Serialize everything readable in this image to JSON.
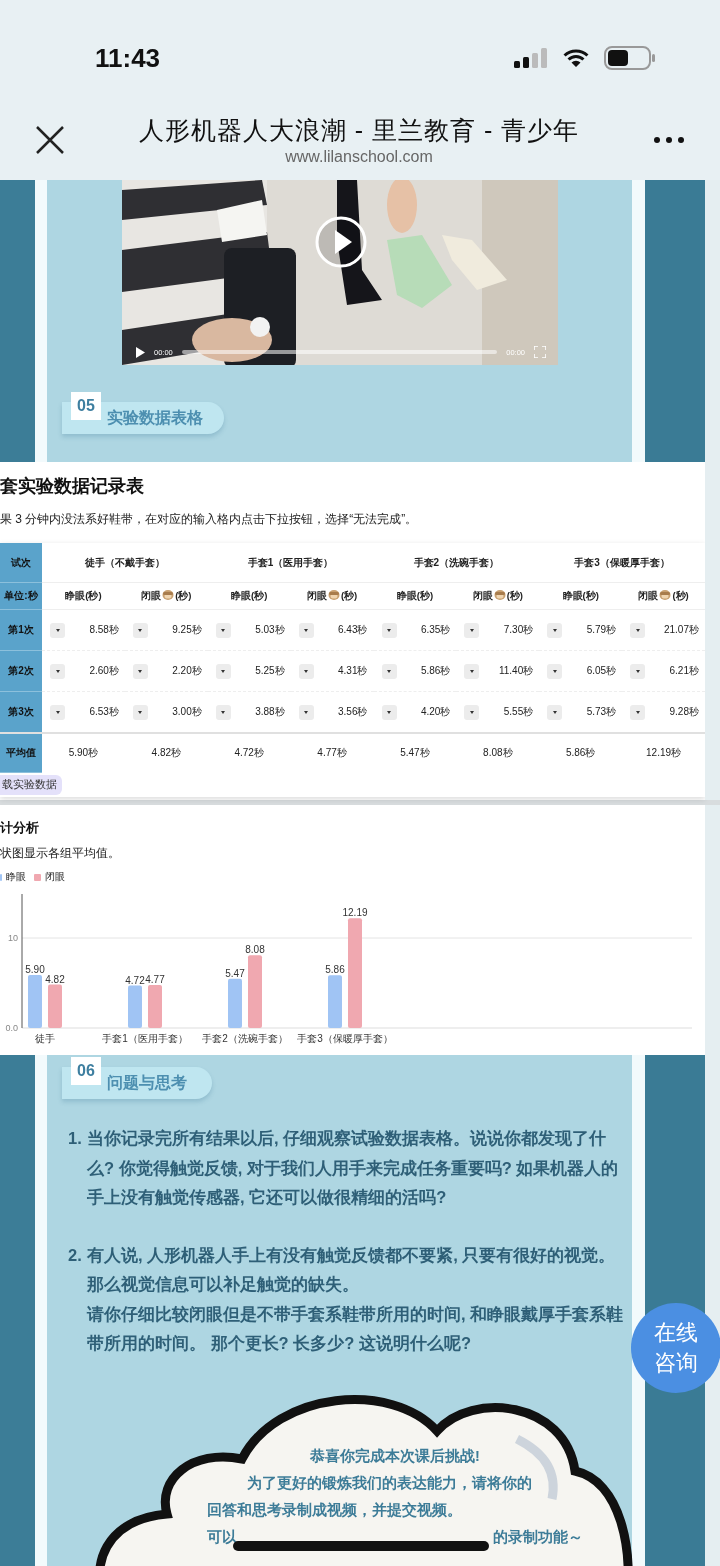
{
  "status_bar": {
    "time": "11:43"
  },
  "browser": {
    "title": "人形机器人大浪潮 - 里兰教育 - 青少年",
    "url": "www.lilanschool.com"
  },
  "video": {
    "kind": "picture",
    "current_time": "00:00",
    "duration": "00:00",
    "level": 0
  },
  "section_05": {
    "number": "05",
    "title": "实验数据表格"
  },
  "table_panel": {
    "title": "套实验数据记录表",
    "note": "果 3 分钟内没法系好鞋带，在对应的输入格内点击下拉按钮，选择“无法完成”。",
    "download_button": "载实验数据"
  },
  "table": {
    "corner": "试次",
    "unit": "单位:秒",
    "groups": [
      "徒手（不戴手套）",
      "手套1（医用手套）",
      "手套2（洗碗手套）",
      "手套3（保暖厚手套）"
    ],
    "subheads": [
      {
        "kind": "text",
        "text": "睁眼(秒)"
      },
      {
        "kind": "emoji",
        "before": "闭眼",
        "after": "(秒)"
      },
      {
        "kind": "text",
        "text": "睁眼(秒)"
      },
      {
        "kind": "emoji",
        "before": "闭眼",
        "after": "(秒)"
      },
      {
        "kind": "text",
        "text": "睁眼(秒)"
      },
      {
        "kind": "emoji",
        "before": "闭眼",
        "after": "(秒)"
      },
      {
        "kind": "text",
        "text": "睁眼(秒)"
      },
      {
        "kind": "emoji",
        "before": "闭眼",
        "after": "(秒)"
      }
    ],
    "rows": [
      {
        "label": "第1次",
        "cells": [
          "8.58秒",
          "9.25秒",
          "5.03秒",
          "6.43秒",
          "6.35秒",
          "7.30秒",
          "5.79秒",
          "21.07秒"
        ]
      },
      {
        "label": "第2次",
        "cells": [
          "2.60秒",
          "2.20秒",
          "5.25秒",
          "4.31秒",
          "5.86秒",
          "11.40秒",
          "6.05秒",
          "6.21秒"
        ]
      },
      {
        "label": "第3次",
        "cells": [
          "6.53秒",
          "3.00秒",
          "3.88秒",
          "3.56秒",
          "4.20秒",
          "5.55秒",
          "5.73秒",
          "9.28秒"
        ]
      }
    ],
    "average": {
      "label": "平均值",
      "cells": [
        "5.90秒",
        "4.82秒",
        "4.72秒",
        "4.77秒",
        "5.47秒",
        "8.08秒",
        "5.86秒",
        "12.19秒"
      ]
    }
  },
  "chart_panel": {
    "title": "计分析",
    "subtitle": "状图显示各组平均值。",
    "chart_data": {
      "type": "bar",
      "categories": [
        "徒手",
        "手套1（医用手套）",
        "手套2（洗碗手套）",
        "手套3（保暖厚手套）"
      ],
      "series": [
        {
          "name": "睁眼",
          "color": "#a0c4f4",
          "values": [
            5.9,
            4.72,
            5.47,
            5.86
          ],
          "value_labels": [
            "5.90",
            "4.72",
            "5.47",
            "5.86"
          ]
        },
        {
          "name": "闭眼",
          "color": "#f0a8b0",
          "values": [
            4.82,
            4.77,
            8.08,
            12.19
          ],
          "value_labels": [
            "4.82",
            "4.77",
            "8.08",
            "12.19"
          ]
        }
      ],
      "ylim": [
        0,
        15
      ],
      "yticks": [
        {
          "value": 0,
          "label": "0.0"
        },
        10
      ],
      "data_labels": true
    }
  },
  "section_06": {
    "number": "06",
    "title": "问题与思考"
  },
  "questions": [
    {
      "number": "1.",
      "paragraphs": [
        "当你记录完所有结果以后, 仔细观察试验数据表格。说说你都发现了什么? 你觉得触觉反馈, 对于我们人用手来完成任务重要吗? 如果机器人的手上没有触觉传感器, 它还可以做很精细的活吗?"
      ]
    },
    {
      "number": "2.",
      "paragraphs": [
        "有人说, 人形机器人手上有没有触觉反馈都不要紧, 只要有很好的视觉。那么视觉信息可以补足触觉的缺失。",
        "请你仔细比较闭眼但是不带手套系鞋带所用的时间, 和睁眼戴厚手套系鞋带所用的时间。 那个更长? 长多少?  这说明什么呢?"
      ]
    }
  ],
  "cloud": {
    "lines": [
      "恭喜你完成本次课后挑战!",
      "为了更好的锻炼我们的表达能力，请将你的",
      "回答和思考录制成视频，并提交视频。"
    ],
    "last_line_start": "可以",
    "last_line_end": "的录制功能～"
  },
  "consult_button": {
    "lines": [
      "在线",
      "咨询"
    ]
  }
}
